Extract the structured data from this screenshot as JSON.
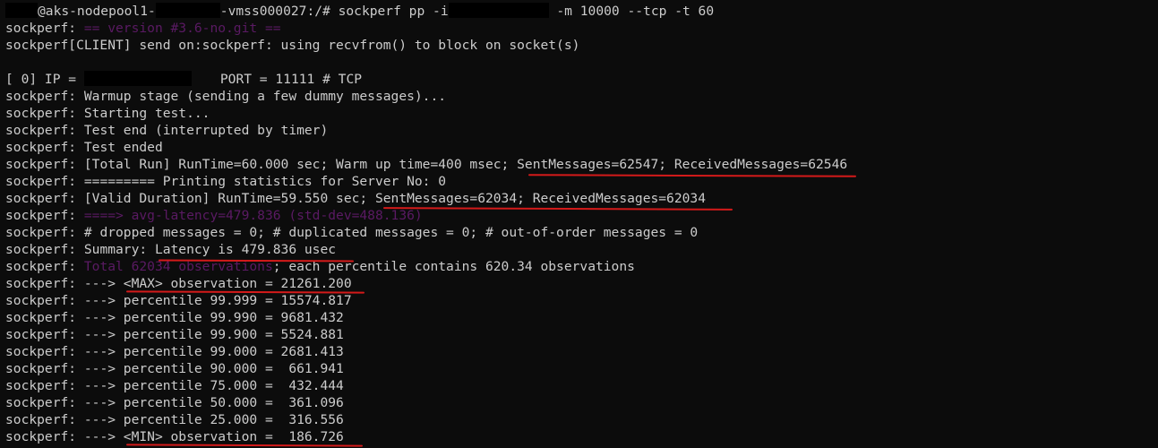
{
  "terminal": {
    "prompt_host": "@aks-nodepool1-",
    "prompt_host_suffix": "-vmss000027:/# ",
    "command": "sockperf pp -i",
    "command_args": " -m 10000 --tcp -t 60",
    "prefix": "sockperf: ",
    "lines": {
      "version": "== version #3.6-no.git ==",
      "client": "sockperf[CLIENT] send on:sockperf: using recvfrom() to block on socket(s)",
      "ip_prefix": "[ 0] IP = ",
      "ip_port": "PORT = 11111 # TCP",
      "warmup": "Warmup stage (sending a few dummy messages)...",
      "starting": "Starting test...",
      "test_end": "Test end (interrupted by timer)",
      "test_ended": "Test ended",
      "total_run_a": "[Total Run] RunTime=60.000 sec; Warm up time=400 msec; ",
      "total_run_b": "SentMessages=62547; ReceivedMessages=62546",
      "printing": "========= Printing statistics for Server No: 0",
      "valid_a": "[Valid Duration] RunTime=59.550 sec; ",
      "valid_b": "SentMessages=62034; ReceivedMessages=62034",
      "avg_latency": "====> avg-latency=479.836 (std-dev=488.136)",
      "dropped": "# dropped messages = 0; # duplicated messages = 0; # out-of-order messages = 0",
      "summary_a": "Summary: ",
      "summary_b": "Latency is 479.836 usec",
      "observations_a": "Total 62034 observations",
      "observations_b": "; each percentile contains 620.34 observations",
      "max": "---> <MAX> observation = 21261.200",
      "p99999": "---> percentile 99.999 = 15574.817",
      "p99990": "---> percentile 99.990 = 9681.432",
      "p99900": "---> percentile 99.900 = 5524.881",
      "p99000": "---> percentile 99.000 = 2681.413",
      "p90000": "---> percentile 90.000 =  661.941",
      "p75000": "---> percentile 75.000 =  432.444",
      "p50000": "---> percentile 50.000 =  361.096",
      "p25000": "---> percentile 25.000 =  316.556",
      "min": "---> <MIN> observation =  186.726"
    }
  },
  "colors": {
    "background": "#0c0c0c",
    "text": "#cccccc",
    "dim_text": "#5a1a63",
    "underline": "#d41a1a"
  }
}
